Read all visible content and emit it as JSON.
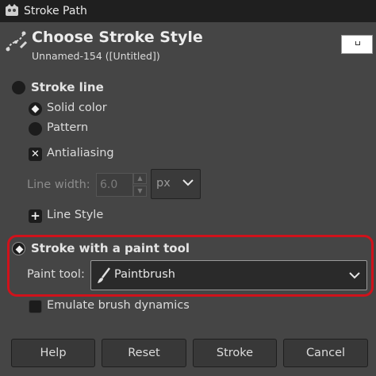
{
  "window": {
    "title": "Stroke Path"
  },
  "header": {
    "title": "Choose Stroke Style",
    "subtitle": "Unnamed-154 ([Untitled])"
  },
  "stroke_line": {
    "label": "Stroke line",
    "selected": false,
    "fill_options": [
      {
        "label": "Solid color",
        "selected": true
      },
      {
        "label": "Pattern",
        "selected": false
      }
    ],
    "antialiasing": {
      "label": "Antialiasing",
      "checked": true
    },
    "line_width": {
      "label": "Line width:",
      "value": "6.0",
      "unit": "px"
    },
    "line_style": {
      "label": "Line Style"
    }
  },
  "paint_tool_section": {
    "label": "Stroke with a paint tool",
    "selected": true,
    "paint_tool_label": "Paint tool:",
    "paint_tool_value": "Paintbrush",
    "emulate_dynamics": {
      "label": "Emulate brush dynamics",
      "checked": false
    }
  },
  "buttons": {
    "help": "Help",
    "reset": "Reset",
    "stroke": "Stroke",
    "cancel": "Cancel"
  },
  "colors": {
    "highlight": "#d0121b",
    "background": "#454545",
    "titlebar": "#1f1f1f"
  },
  "icons": {
    "app": "gimp-icon",
    "header": "stroke-path-icon",
    "tool": "paintbrush-icon"
  }
}
